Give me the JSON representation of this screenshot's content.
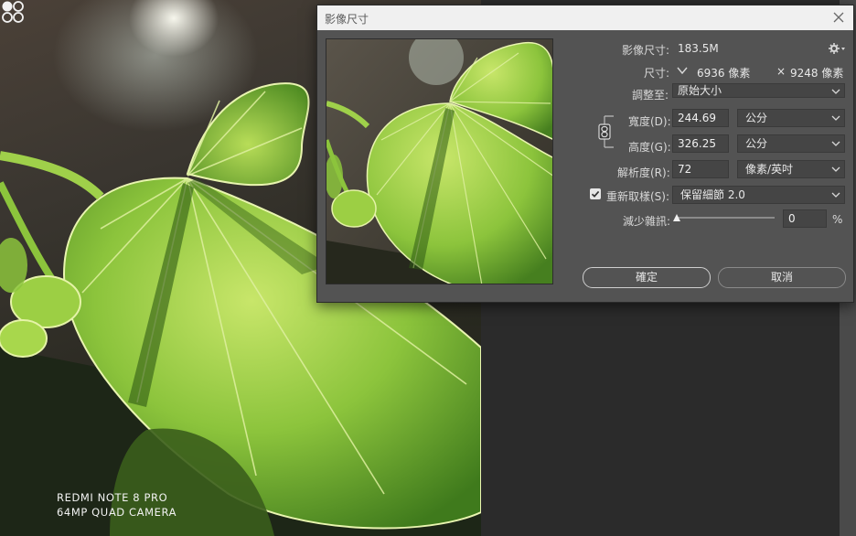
{
  "camera_watermark": {
    "line1": "REDMI NOTE 8 PRO",
    "line2": "64MP QUAD CAMERA"
  },
  "dialog": {
    "title": "影像尺寸",
    "image_size_label": "影像尺寸:",
    "image_size_value": "183.5M",
    "dimensions_label": "尺寸:",
    "dimensions_width": "6936 像素",
    "dimensions_separator": "×",
    "dimensions_height": "9248 像素",
    "fit_to_label": "調整至:",
    "fit_to_value": "原始大小",
    "width_label": "寬度(D):",
    "width_value": "244.69",
    "width_unit": "公分",
    "height_label": "高度(G):",
    "height_value": "326.25",
    "height_unit": "公分",
    "resolution_label": "解析度(R):",
    "resolution_value": "72",
    "resolution_unit": "像素/英吋",
    "resample_label": "重新取樣(S):",
    "resample_checked": true,
    "resample_value": "保留細節 2.0",
    "reduce_noise_label": "減少雜訊:",
    "reduce_noise_value": "0",
    "reduce_noise_unit": "%",
    "reduce_noise_level": 0,
    "ok_label": "確定",
    "cancel_label": "取消"
  },
  "colors": {
    "dialog_bg": "#535353",
    "titlebar_bg": "#f0f0f0",
    "field_bg": "#454545",
    "leaf_green": "#8cc43c"
  }
}
